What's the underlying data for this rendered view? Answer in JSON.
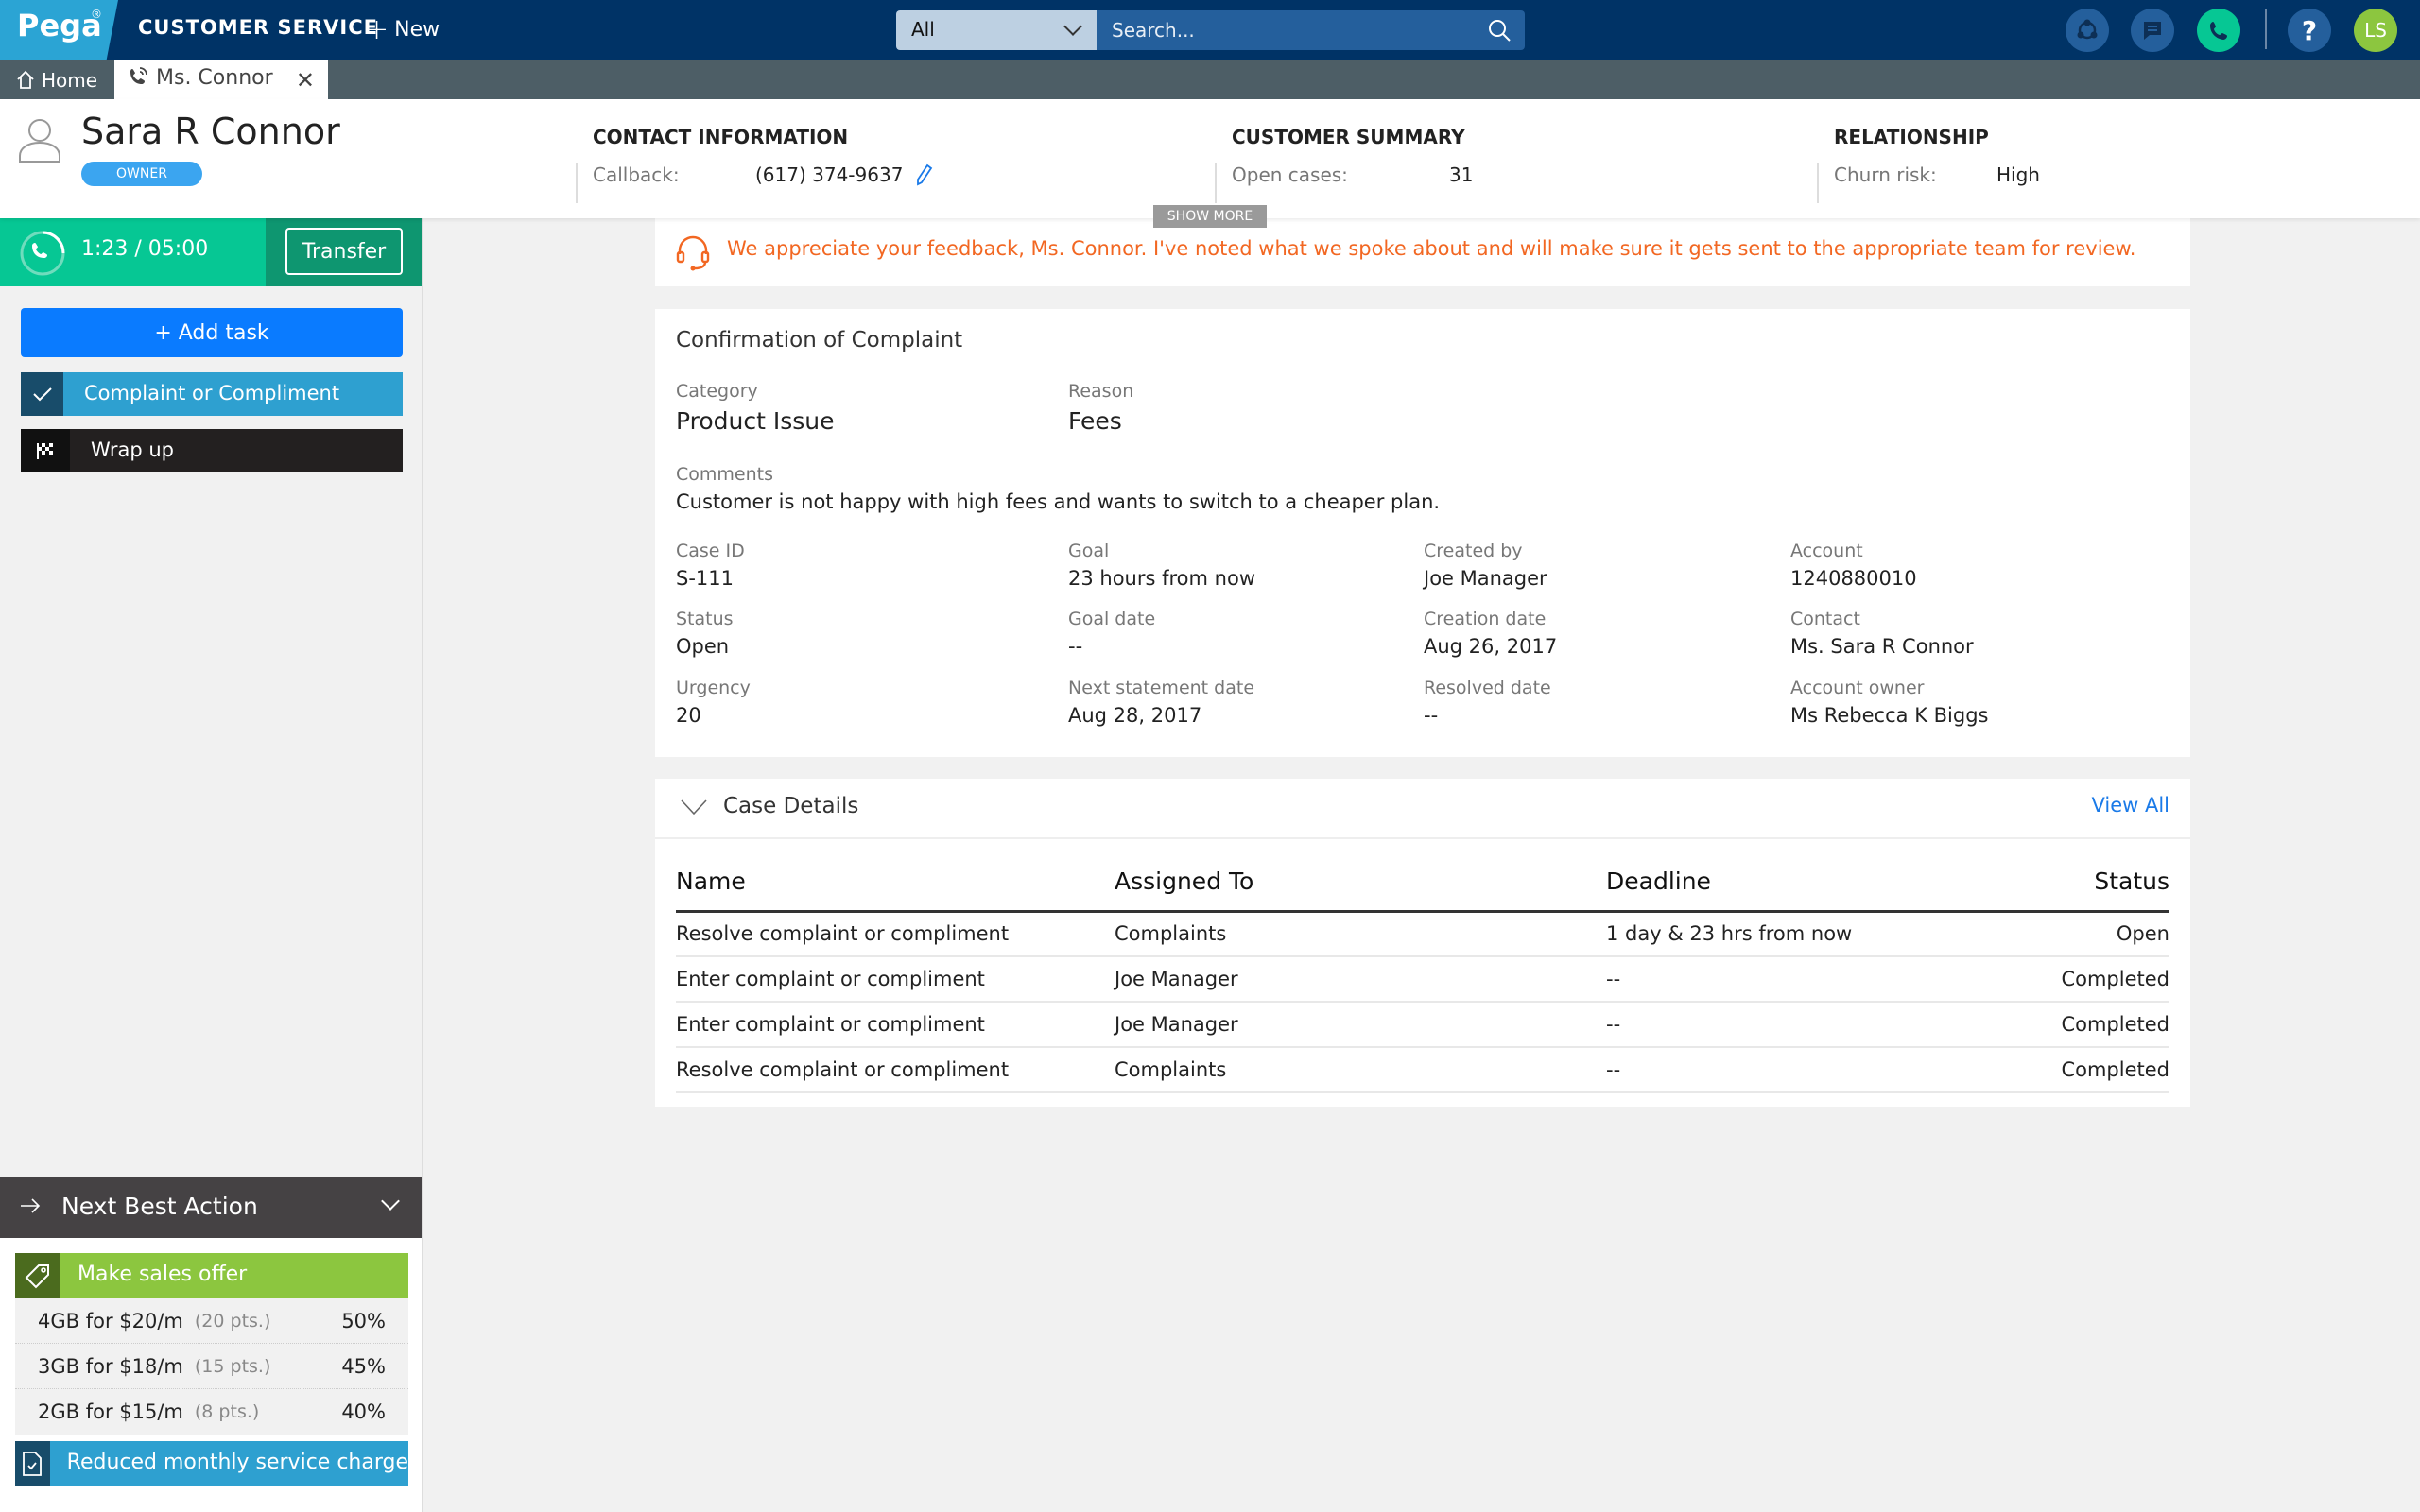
{
  "app": {
    "brand": "Pega",
    "brand_mark": "®",
    "title": "CUSTOMER SERVICE",
    "new_label": "New"
  },
  "search": {
    "scope_selected": "All",
    "placeholder": "Search..."
  },
  "nav_icons": [
    {
      "name": "network-icon",
      "color": "#245f9c"
    },
    {
      "name": "chat-icon",
      "color": "#245f9c"
    },
    {
      "name": "phone-icon",
      "color": "#06c794"
    },
    {
      "name": "help-icon",
      "label": "?",
      "color": "#245f9c"
    },
    {
      "name": "user-avatar",
      "label": "LS",
      "color": "#8cc63f"
    }
  ],
  "tabs": {
    "home_label": "Home",
    "active_label": "Ms. Connor"
  },
  "customer": {
    "name": "Sara R Connor",
    "badge": "OWNER",
    "contact": {
      "title": "CONTACT INFORMATION",
      "label": "Callback:",
      "value": "(617) 374-9637"
    },
    "summary": {
      "title": "CUSTOMER SUMMARY",
      "label": "Open cases:",
      "value": "31"
    },
    "relationship": {
      "title": "RELATIONSHIP",
      "label": "Churn risk:",
      "value": "High"
    },
    "show_more": "SHOW MORE"
  },
  "call": {
    "time": "1:23 / 05:00",
    "transfer_label": "Transfer"
  },
  "sidebar": {
    "add_task_label": "Add task",
    "tasks": [
      {
        "label": "Complaint or Compliment",
        "status": "completed"
      },
      {
        "label": "Wrap up",
        "status": "pending"
      }
    ]
  },
  "nba": {
    "title": "Next Best Action",
    "offer_title": "Make sales offer",
    "offers": [
      {
        "name": "4GB for $20/m",
        "points": "(20 pts.)",
        "percent": "50%"
      },
      {
        "name": "3GB for $18/m",
        "points": "(15 pts.)",
        "percent": "45%"
      },
      {
        "name": "2GB for $15/m",
        "points": "(8 pts.)",
        "percent": "40%"
      }
    ],
    "second_action": "Reduced monthly service charge"
  },
  "feedback": {
    "message": "We appreciate your feedback, Ms. Connor. I've noted what we spoke about and will make sure it gets sent to the appropriate team for review.",
    "color": "#f26722"
  },
  "confirmation": {
    "title": "Confirmation of Complaint",
    "category_label": "Category",
    "category_value": "Product Issue",
    "reason_label": "Reason",
    "reason_value": "Fees",
    "comments_label": "Comments",
    "comments_value": "Customer is not happy with high fees and wants to switch to a cheaper plan.",
    "fields": [
      {
        "label": "Case ID",
        "value": "S-111"
      },
      {
        "label": "Goal",
        "value": "23 hours from now"
      },
      {
        "label": "Created by",
        "value": "Joe Manager"
      },
      {
        "label": "Account",
        "value": "1240880010"
      },
      {
        "label": "Status",
        "value": "Open"
      },
      {
        "label": "Goal date",
        "value": "--"
      },
      {
        "label": "Creation date",
        "value": "Aug 26, 2017"
      },
      {
        "label": "Contact",
        "value": "Ms. Sara R Connor"
      },
      {
        "label": "Urgency",
        "value": "20"
      },
      {
        "label": "Next statement date",
        "value": "Aug 28, 2017"
      },
      {
        "label": "Resolved date",
        "value": "--"
      },
      {
        "label": "Account owner",
        "value": "Ms Rebecca K Biggs"
      }
    ]
  },
  "case_details": {
    "title": "Case Details",
    "view_all": "View All",
    "columns": [
      "Name",
      "Assigned To",
      "Deadline",
      "Status"
    ],
    "rows": [
      [
        "Resolve complaint or compliment",
        "Complaints",
        "1 day & 23 hrs from now",
        "Open"
      ],
      [
        "Enter complaint or compliment",
        "Joe Manager",
        "--",
        "Completed"
      ],
      [
        "Enter complaint or compliment",
        "Joe Manager",
        "--",
        "Completed"
      ],
      [
        "Resolve complaint or compliment",
        "Complaints",
        "--",
        "Completed"
      ]
    ]
  }
}
